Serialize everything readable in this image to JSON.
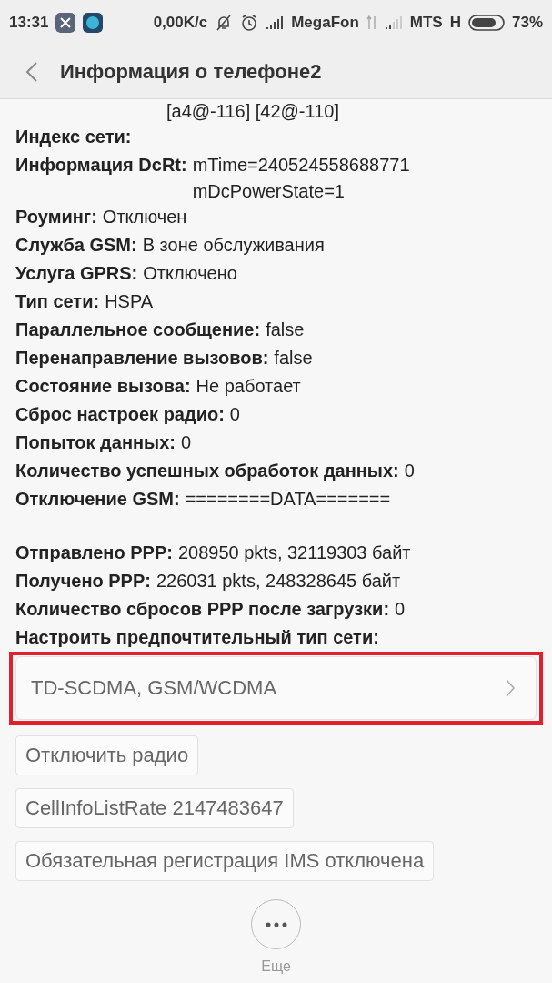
{
  "status_bar": {
    "time": "13:31",
    "speed": "0,00K/c",
    "carrier_1": "MegaFon",
    "carrier_2": "MTS",
    "network_type": "H",
    "battery": "73%"
  },
  "header": {
    "title": "Информация о телефоне2"
  },
  "rows": [
    {
      "kind": "continuation",
      "value": [
        "[a4@-116] [42@-110]"
      ]
    },
    {
      "kind": "field",
      "label": "Индекс сети:",
      "value": []
    },
    {
      "kind": "field",
      "label": "Информация DcRt:",
      "value": [
        "mTime=240524558688771",
        "mDcPowerState=1"
      ]
    },
    {
      "kind": "field",
      "label": "Роуминг:",
      "value": [
        "Отключен"
      ]
    },
    {
      "kind": "field",
      "label": "Служба GSM:",
      "value": [
        "В зоне обслуживания"
      ]
    },
    {
      "kind": "field",
      "label": "Услуга GPRS:",
      "value": [
        "Отключено"
      ]
    },
    {
      "kind": "field",
      "label": "Тип сети:",
      "value": [
        "HSPA"
      ]
    },
    {
      "kind": "field",
      "label": "Параллельное сообщение:",
      "value": [
        "false"
      ]
    },
    {
      "kind": "field",
      "label": "Перенаправление вызовов:",
      "value": [
        "false"
      ]
    },
    {
      "kind": "field",
      "label": "Состояние вызова:",
      "value": [
        "Не работает"
      ]
    },
    {
      "kind": "field",
      "label": "Сброс настроек радио:",
      "value": [
        "0"
      ]
    },
    {
      "kind": "field",
      "label": "Попыток данных:",
      "value": [
        "0"
      ]
    },
    {
      "kind": "field",
      "label": "Количество успешных обработок данных:",
      "value": [
        "0"
      ]
    },
    {
      "kind": "field",
      "label": "Отключение GSM:",
      "value": [
        "========DATA======="
      ]
    },
    {
      "kind": "spacer"
    },
    {
      "kind": "field",
      "label": "Отправлено PPP:",
      "value": [
        "208950 pkts, 32119303 байт"
      ]
    },
    {
      "kind": "field",
      "label": "Получено PPP:",
      "value": [
        "226031 pkts, 248328645 байт"
      ]
    },
    {
      "kind": "field",
      "label": "Количество сбросов PPP после загрузки:",
      "value": [
        "0"
      ]
    },
    {
      "kind": "field",
      "label": "Настроить предпочтительный тип сети:",
      "value": []
    }
  ],
  "network_select": {
    "value": "TD-SCDMA, GSM/WCDMA",
    "highlighted": true
  },
  "buttons": [
    "Отключить радио",
    "CellInfoListRate 2147483647",
    "Обязательная регистрация IMS отключена"
  ],
  "more": {
    "label": "Еще"
  }
}
